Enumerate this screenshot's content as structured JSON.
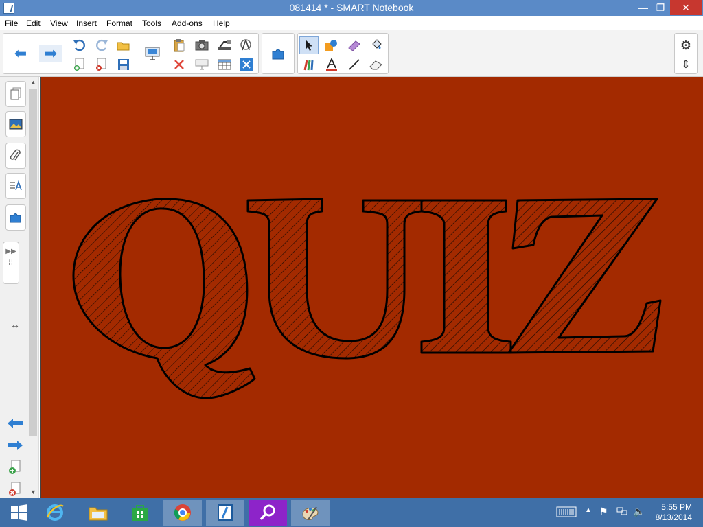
{
  "window": {
    "title": "081414 * - SMART Notebook",
    "min_glyph": "—",
    "max_glyph": "❐",
    "close_glyph": "✕"
  },
  "menu": [
    "File",
    "Edit",
    "View",
    "Insert",
    "Format",
    "Tools",
    "Add-ons",
    "Help"
  ],
  "toolbar": {
    "back_glyph": "⬅",
    "forward_glyph": "➡"
  },
  "canvas": {
    "background": "#a32a00",
    "art_text": "QUIZ"
  },
  "taskbar": {
    "time": "5:55 PM",
    "date": "8/13/2014"
  }
}
